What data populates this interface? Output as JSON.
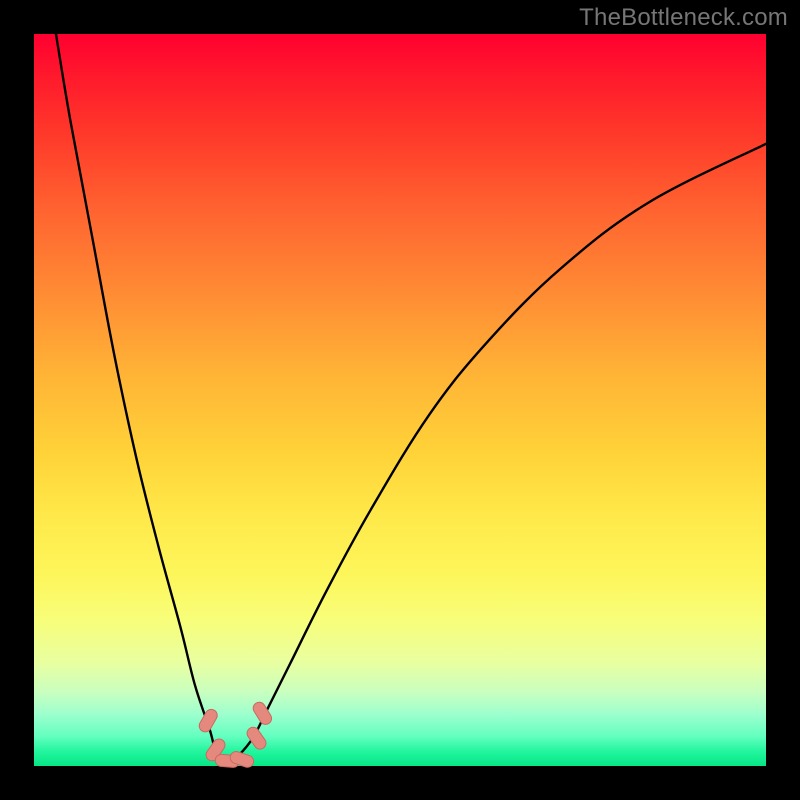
{
  "watermark": "TheBottleneck.com",
  "colors": {
    "frame": "#000000",
    "curve_stroke": "#000000",
    "marker_fill": "#e5897e",
    "marker_stroke": "#c96a5f",
    "watermark": "#767676"
  },
  "chart_data": {
    "type": "line",
    "title": "",
    "xlabel": "",
    "ylabel": "",
    "xlim": [
      0,
      100
    ],
    "ylim": [
      0,
      100
    ],
    "grid": false,
    "legend": null,
    "note": "Curve is a V-shaped bottleneck curve. x ≈ relative component strength (arbitrary units 0–100 mapped to plot width). y ≈ bottleneck severity (0 at bottom/green = no bottleneck, 100 at top/red = severe).",
    "series": [
      {
        "name": "bottleneck-curve",
        "x": [
          3,
          5,
          8,
          11,
          14,
          17,
          20,
          22,
          24,
          25,
          26.5,
          28,
          30,
          32,
          35,
          40,
          46,
          54,
          62,
          72,
          84,
          100
        ],
        "y": [
          100,
          88,
          72,
          56,
          42,
          30,
          19,
          11,
          5,
          1.5,
          0.5,
          1.5,
          4,
          8,
          14,
          24,
          35,
          48,
          58,
          68,
          77,
          85
        ]
      }
    ],
    "markers": [
      {
        "name": "point-left-upper",
        "x": 23.8,
        "y": 6.2,
        "angle": -60
      },
      {
        "name": "point-left-lower",
        "x": 24.8,
        "y": 2.2,
        "angle": -55
      },
      {
        "name": "point-bottom-a",
        "x": 26.4,
        "y": 0.7,
        "angle": 5
      },
      {
        "name": "point-bottom-b",
        "x": 28.4,
        "y": 0.9,
        "angle": 18
      },
      {
        "name": "point-right-lower",
        "x": 30.4,
        "y": 3.8,
        "angle": 55
      },
      {
        "name": "point-right-upper",
        "x": 31.2,
        "y": 7.2,
        "angle": 58
      }
    ]
  }
}
